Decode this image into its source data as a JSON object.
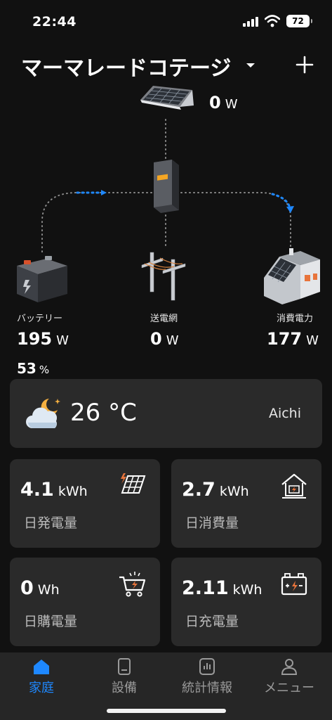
{
  "status_bar": {
    "time": "22:44",
    "battery": "72"
  },
  "header": {
    "title": "マーマレードコテージ",
    "icons": [
      "chevron-down-icon",
      "plus-icon"
    ]
  },
  "flow": {
    "solar": {
      "value": "0",
      "unit": "W",
      "icon": "solar-panel-icon"
    },
    "inverter": {
      "icon": "inverter-icon",
      "accent": "#f5a623"
    },
    "battery": {
      "label": "バッテリー",
      "value": "195",
      "unit": "W",
      "percent": "53",
      "percent_unit": "%",
      "icon": "battery-icon"
    },
    "grid": {
      "label": "送電網",
      "value": "0",
      "unit": "W",
      "icon": "power-pole-icon"
    },
    "home": {
      "label": "消費電力",
      "value": "177",
      "unit": "W",
      "icon": "house-icon"
    },
    "flow_color": "#1e88ff",
    "line_color": "#8a8a8a"
  },
  "weather": {
    "temperature": "26 °C",
    "location": "Aichi",
    "icon": "moon-cloud-icon"
  },
  "tiles": [
    {
      "value": "4.1",
      "unit": "kWh",
      "label": "日発電量",
      "icon": "solar-panel-icon"
    },
    {
      "value": "2.7",
      "unit": "kWh",
      "label": "日消費量",
      "icon": "house-icon"
    },
    {
      "value": "0",
      "unit": "Wh",
      "label": "日購電量",
      "icon": "cart-icon"
    },
    {
      "value": "2.11",
      "unit": "kWh",
      "label": "日充電量",
      "icon": "battery-icon"
    }
  ],
  "nav": [
    {
      "label": "家庭",
      "icon": "home-icon",
      "active": true
    },
    {
      "label": "設備",
      "icon": "device-icon",
      "active": false
    },
    {
      "label": "統計情報",
      "icon": "chart-icon",
      "active": false
    },
    {
      "label": "メニュー",
      "icon": "user-icon",
      "active": false
    }
  ],
  "colors": {
    "background": "#111111",
    "card": "#2a2a2a",
    "accent_blue": "#1e88ff",
    "accent_orange": "#e8743b"
  }
}
